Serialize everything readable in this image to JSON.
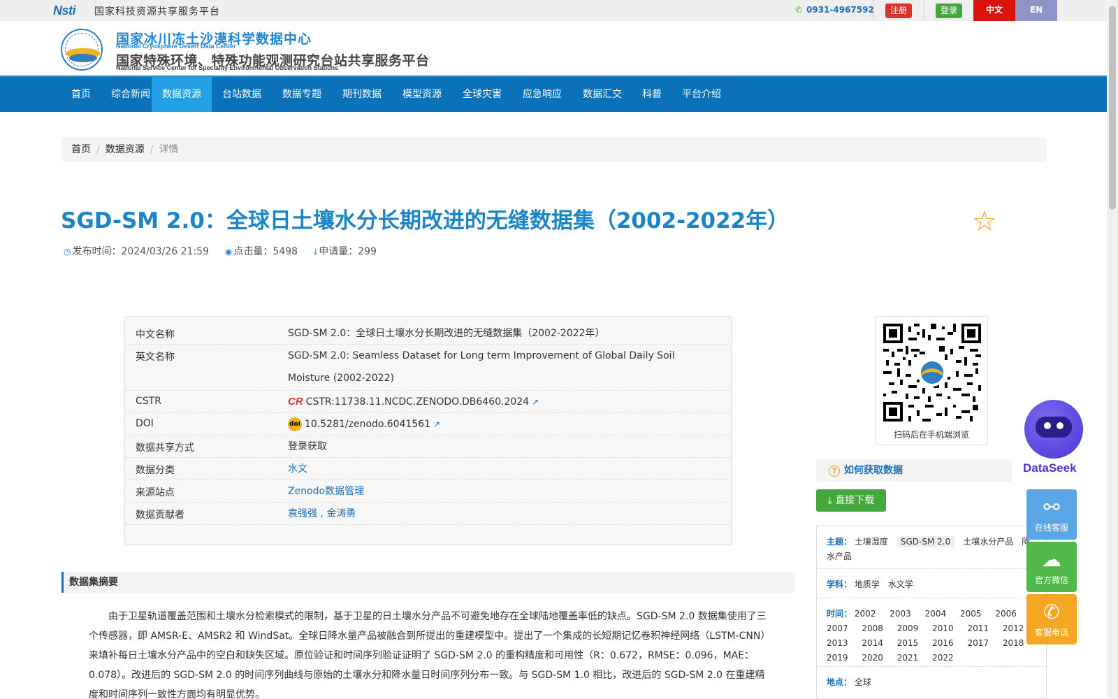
{
  "topbar": {
    "logo_text": "Nsti",
    "platform_name": "国家科技资源共享服务平台",
    "phone": "0931-4967592",
    "register_label": "注册",
    "login_label": "登录",
    "lang_zh": "中文",
    "lang_en": "EN"
  },
  "header": {
    "title_cn": "国家冰川冻土沙漠科学数据中心",
    "title_en": "National Cryosphere Desert Data Center",
    "subtitle_cn": "国家特殊环境、特殊功能观测研究台站共享服务平台",
    "subtitle_en": "National Service Center for Speciality Environmental Observation Stations"
  },
  "nav": {
    "items": [
      "首页",
      "综合新闻",
      "数据资源",
      "台站数据",
      "数据专题",
      "期刊数据",
      "模型资源",
      "全球灾害",
      "应急响应",
      "数据汇交",
      "科普",
      "平台介绍"
    ],
    "active_index": 2
  },
  "breadcrumb": {
    "home": "首页",
    "section": "数据资源",
    "current": "详情",
    "divider": "/"
  },
  "dataset": {
    "title": "SGD-SM 2.0：全球日土壤水分长期改进的无缝数据集（2002-2022年）",
    "publish_label": "发布时间：",
    "publish_time": "2024/03/26 21:59",
    "views_label": "点击量：",
    "views": "5498",
    "requests_label": "申请量：",
    "requests": "299"
  },
  "info": {
    "cn_name_key": "中文名称",
    "cn_name": "SGD-SM 2.0：全球日土壤水分长期改进的无缝数据集（2002-2022年）",
    "en_name_key": "英文名称",
    "en_name": "SGD-SM 2.0: Seamless Dataset for Long term Improvement of Global Daily Soil Moisture (2002-2022)",
    "cstr_key": "CSTR",
    "cstr": "CSTR:11738.11.NCDC.ZENODO.DB6460.2024",
    "doi_key": "DOI",
    "doi": "10.5281/zenodo.6041561",
    "share_key": "数据共享方式",
    "share": "登录获取",
    "category_key": "数据分类",
    "category": "水文",
    "source_key": "来源站点",
    "source": "Zenodo数据管理",
    "contributors_key": "数据贡献者",
    "contributors": "袁强强 , 金涛勇"
  },
  "abstract": {
    "heading": "数据集摘要",
    "text": "由于卫星轨道覆盖范围和土壤水分检索模式的限制，基于卫星的日土壤水分产品不可避免地存在全球陆地覆盖率低的缺点。SGD-SM 2.0 数据集使用了三个传感器，即 AMSR-E、AMSR2 和 WindSat。全球日降水量产品被融合到所提出的重建模型中。提出了一个集成的长短期记忆卷积神经网络（LSTM-CNN）来填补每日土壤水分产品中的空白和缺失区域。原位验证和时间序列验证证明了 SGD-SM 2.0 的重构精度和可用性（R：0.672，RMSE：0.096，MAE：0.078）。改进后的 SGD-SM 2.0 的时间序列曲线与原始的土壤水分和降水量日时间序列分布一致。与 SGD-SM 1.0 相比，改进后的 SGD-SM 2.0 在重建精度和时间序列一致性方面均有明显优势。"
  },
  "sidebar": {
    "qr_caption": "扫码后在手机端浏览",
    "howto_label": "如何获取数据",
    "download_label": "直接下载",
    "theme_label": "主题：",
    "themes": [
      "土壤湿度",
      "SGD-SM 2.0",
      "土壤水分产品",
      "降",
      "水产品"
    ],
    "subject_label": "学科：",
    "subjects": [
      "地质学",
      "水文学"
    ],
    "time_label": "时间：",
    "years": [
      "2002",
      "2003",
      "2004",
      "2005",
      "2006",
      "2007",
      "2008",
      "2009",
      "2010",
      "2011",
      "2012",
      "2013",
      "2014",
      "2015",
      "2016",
      "2017",
      "2018",
      "2019",
      "2020",
      "2021",
      "2022"
    ],
    "place_label": "地点：",
    "place": "全球"
  },
  "widgets": {
    "dataseek": "DataSeek",
    "online_service": "在线客服",
    "wechat": "官方微信",
    "hotline": "客服电话"
  },
  "colors": {
    "nav_bg": "#0b71b8",
    "nav_active": "#23a0e6",
    "title_blue": "#1a86c8",
    "link_blue": "#1a6fb8",
    "register_red": "#d9342b",
    "login_green": "#44a83c",
    "widget_blue": "#5aa5e6",
    "widget_green": "#52b84a",
    "widget_orange": "#f5a623"
  }
}
